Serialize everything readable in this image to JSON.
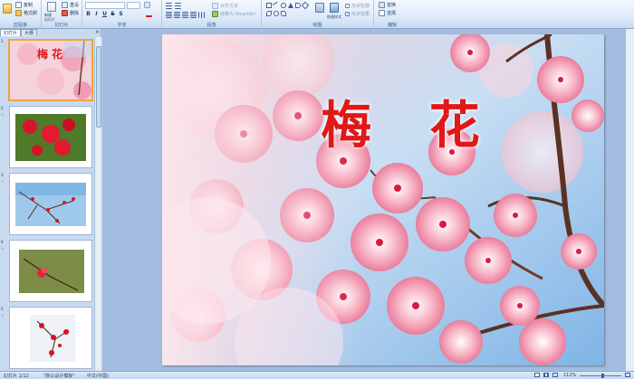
{
  "ribbon": {
    "clipboard": {
      "copy_label": "复制",
      "format_painter_label": "格式刷",
      "group_label": "剪贴板"
    },
    "slides": {
      "new_slide_label": "新建\n幻灯片",
      "reset_label": "重设",
      "delete_label": "删除",
      "group_label": "幻灯片"
    },
    "font": {
      "group_label": "字体"
    },
    "paragraph": {
      "text_direction_label": "对齐文本",
      "smartart_label": "转换为 SmartArt",
      "group_label": "段落"
    },
    "drawing": {
      "quick_styles_label": "快速样式",
      "shape_outline_label": "形状轮廓",
      "shape_effect_label": "形状效果",
      "group_label": "绘图"
    },
    "editing": {
      "replace_label": "替换",
      "select_label": "选择",
      "group_label": "编辑"
    }
  },
  "left_panel": {
    "tabs": [
      {
        "label": "幻灯片",
        "active": true
      },
      {
        "label": "大纲",
        "active": false
      }
    ],
    "close_glyph": "×",
    "slides": [
      {
        "number": "1",
        "title": "梅 花",
        "selected": true
      },
      {
        "number": "2",
        "title": "",
        "selected": false
      },
      {
        "number": "3",
        "title": "",
        "selected": false
      },
      {
        "number": "4",
        "title": "",
        "selected": false
      },
      {
        "number": "5",
        "title": "",
        "selected": false
      }
    ]
  },
  "slide": {
    "title": "梅 花"
  },
  "status_bar": {
    "slide_position": "幻灯片 1/12",
    "theme": "\"默认设计模板\"",
    "language": "中文(中国)",
    "zoom": "112%"
  },
  "colors": {
    "title_red": "#e01818",
    "ribbon_bg": "#d9e7f8",
    "selection_orange": "#f0a43b",
    "workspace_blue": "#a2bde0"
  }
}
